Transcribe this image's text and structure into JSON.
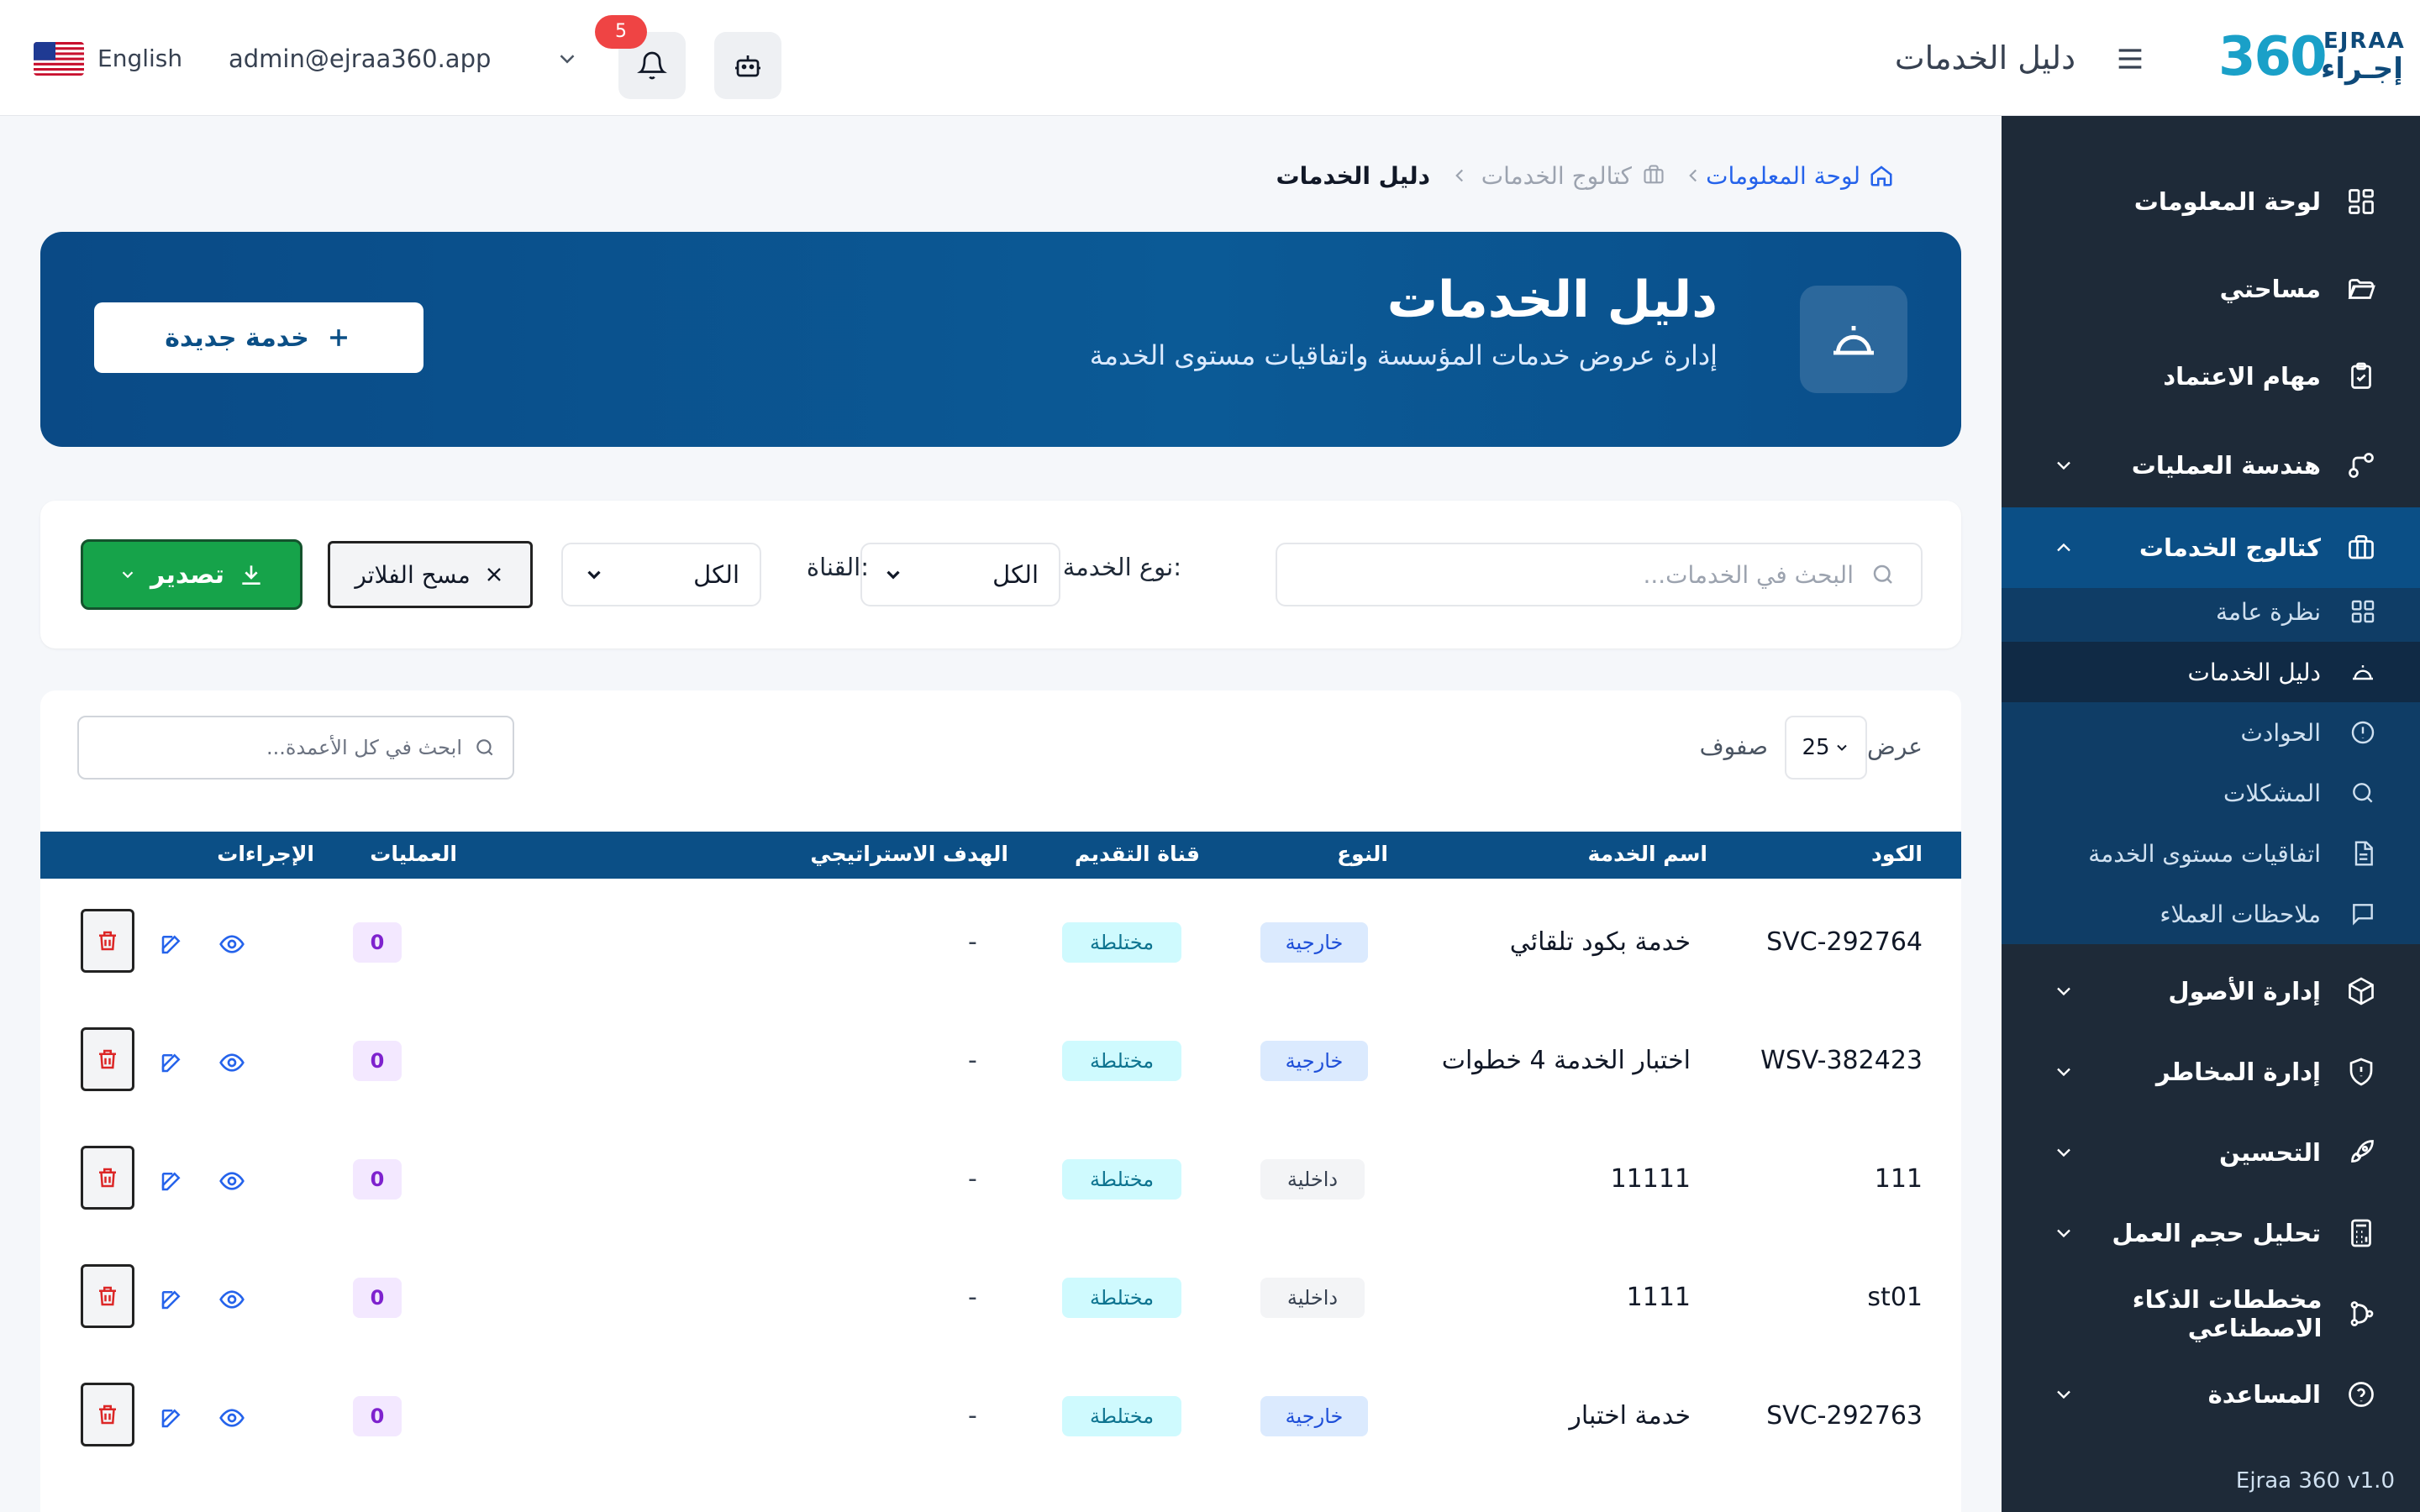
{
  "topbar": {
    "language": "English",
    "user_email": "admin@ejraa360.app",
    "notification_count": "5",
    "page_title": "دليل الخدمات",
    "logo_number": "360",
    "logo_en": "EJRAA",
    "logo_ar": "إجـراء"
  },
  "sidebar": {
    "items": [
      {
        "label": "لوحة المعلومات",
        "icon": "dashboard-icon"
      },
      {
        "label": "مساحتي",
        "icon": "folder-icon"
      },
      {
        "label": "مهام الاعتماد",
        "icon": "clipboard-check-icon"
      },
      {
        "label": "هندسة العمليات",
        "icon": "process-icon"
      },
      {
        "label": "كتالوج الخدمات",
        "icon": "briefcase-icon"
      },
      {
        "label": "إدارة الأصول",
        "icon": "box-icon"
      },
      {
        "label": "إدارة المخاطر",
        "icon": "shield-icon"
      },
      {
        "label": "التحسين",
        "icon": "rocket-icon"
      },
      {
        "label": "تحليل حجم العمل",
        "icon": "calculator-icon"
      },
      {
        "label": "مخططات الذكاء الاصطناعي",
        "icon": "ai-flow-icon"
      },
      {
        "label": "المساعدة",
        "icon": "help-icon"
      }
    ],
    "subitems": [
      {
        "label": "نظرة عامة",
        "icon": "grid-icon"
      },
      {
        "label": "دليل الخدمات",
        "icon": "service-bell-icon"
      },
      {
        "label": "الحوادث",
        "icon": "alert-circle-icon"
      },
      {
        "label": "المشكلات",
        "icon": "search-icon"
      },
      {
        "label": "اتفاقيات مستوى الخدمة",
        "icon": "document-icon"
      },
      {
        "label": "ملاحظات العملاء",
        "icon": "message-icon"
      }
    ],
    "version": "Ejraa 360 v1.0"
  },
  "breadcrumb": {
    "home": "لوحة المعلومات",
    "catalog": "كتالوج الخدمات",
    "current": "دليل الخدمات"
  },
  "hero": {
    "title": "دليل الخدمات",
    "subtitle": "إدارة عروض خدمات المؤسسة واتفاقيات مستوى الخدمة",
    "new_button": "خدمة جديدة"
  },
  "filters": {
    "search_placeholder": "البحث في الخدمات...",
    "service_type_label": "نوع الخدمة:",
    "service_type_value": "الكل",
    "channel_label": "القناة:",
    "channel_value": "الكل",
    "clear_button": "مسح الفلاتر",
    "export_button": "تصدير"
  },
  "table": {
    "show_label": "عرض",
    "rows_value": "25",
    "rows_label": "صفوف",
    "column_search_placeholder": "ابحث في كل الأعمدة...",
    "headers": {
      "code": "الكود",
      "name": "اسم الخدمة",
      "type": "النوع",
      "channel": "قناة التقديم",
      "goal": "الهدف الاستراتيجي",
      "operations": "العمليات",
      "actions": "الإجراءات"
    },
    "rows": [
      {
        "code": "SVC-292764",
        "name": "خدمة بكود تلقائي",
        "type": "خارجية",
        "channel": "مختلطة",
        "goal": "-",
        "operations": "0"
      },
      {
        "code": "WSV-382423",
        "name": "اختبار الخدمة 4 خطوات",
        "type": "خارجية",
        "channel": "مختلطة",
        "goal": "-",
        "operations": "0"
      },
      {
        "code": "111",
        "name": "11111",
        "type": "داخلية",
        "channel": "مختلطة",
        "goal": "-",
        "operations": "0"
      },
      {
        "code": "st01",
        "name": "1111",
        "type": "داخلية",
        "channel": "مختلطة",
        "goal": "-",
        "operations": "0"
      },
      {
        "code": "SVC-292763",
        "name": "خدمة اختبار",
        "type": "خارجية",
        "channel": "مختلطة",
        "goal": "-",
        "operations": "0"
      }
    ]
  },
  "colors": {
    "primary": "#0b4f86",
    "sidebar_bg": "#1e2a38",
    "export_green": "#16a34a",
    "badge_red": "#ef4444"
  }
}
